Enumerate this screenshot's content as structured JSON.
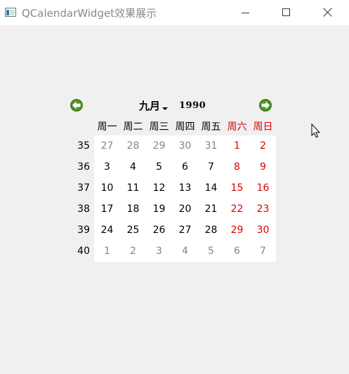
{
  "window": {
    "title": "QCalendarWidget效果展示"
  },
  "calendar": {
    "month": "九月",
    "year": "1990",
    "weekday_headers": [
      "周一",
      "周二",
      "周三",
      "周四",
      "周五",
      "周六",
      "周日"
    ],
    "weeks": [
      {
        "week": "35",
        "days": [
          "27",
          "28",
          "29",
          "30",
          "31",
          "1",
          "2"
        ]
      },
      {
        "week": "36",
        "days": [
          "3",
          "4",
          "5",
          "6",
          "7",
          "8",
          "9"
        ]
      },
      {
        "week": "37",
        "days": [
          "10",
          "11",
          "12",
          "13",
          "14",
          "15",
          "16"
        ]
      },
      {
        "week": "38",
        "days": [
          "17",
          "18",
          "19",
          "20",
          "21",
          "22",
          "23"
        ]
      },
      {
        "week": "39",
        "days": [
          "24",
          "25",
          "26",
          "27",
          "28",
          "29",
          "30"
        ]
      },
      {
        "week": "40",
        "days": [
          "1",
          "2",
          "3",
          "4",
          "5",
          "6",
          "7"
        ]
      }
    ],
    "colors": {
      "weekend": "#e00000",
      "other_month": "#858585",
      "nav_arrow": "#3f7d1e"
    }
  }
}
